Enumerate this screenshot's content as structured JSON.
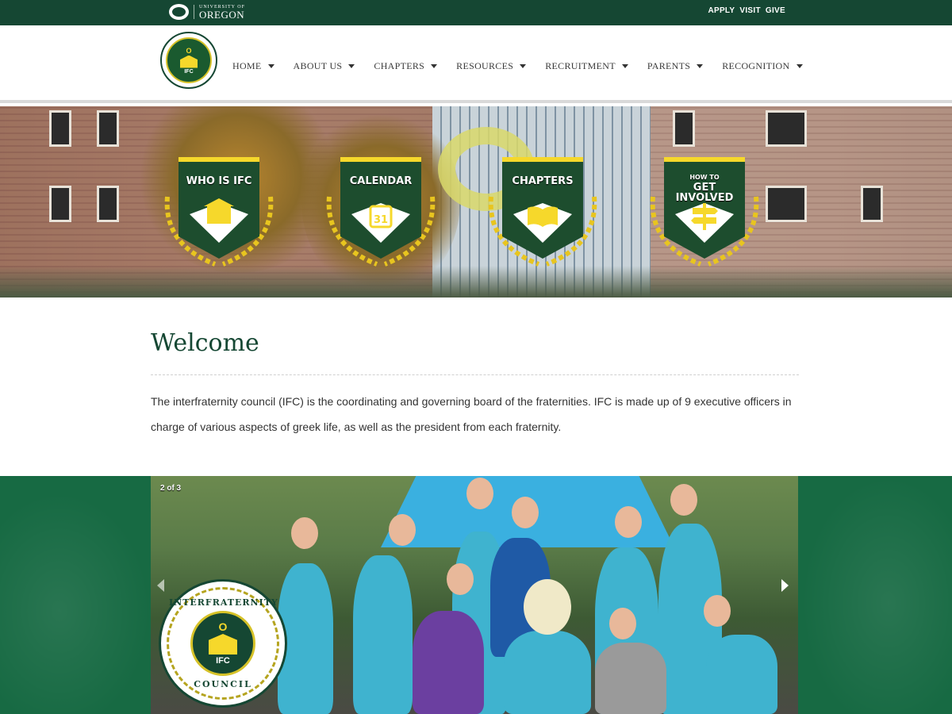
{
  "topbar": {
    "logo_small": "UNIVERSITY OF",
    "logo_big": "OREGON",
    "links": [
      "APPLY",
      "VISIT",
      "GIVE"
    ]
  },
  "header": {
    "seal_ifc": "IFC",
    "nav": [
      "HOME",
      "ABOUT US",
      "CHAPTERS",
      "RESOURCES",
      "RECRUITMENT",
      "PARENTS",
      "RECOGNITION"
    ]
  },
  "hero": {
    "badges": [
      {
        "sub": "",
        "label": "WHO IS IFC",
        "icon": "building-icon"
      },
      {
        "sub": "",
        "label": "CALENDAR",
        "icon": "calendar-icon",
        "icon_text": "31"
      },
      {
        "sub": "",
        "label": "CHAPTERS",
        "icon": "book-icon"
      },
      {
        "sub": "HOW TO",
        "label": "GET INVOLVED",
        "icon": "signpost-icon"
      }
    ]
  },
  "welcome": {
    "title": "Welcome",
    "body": "The interfraternity council (IFC) is the coordinating and governing board of the fraternities. IFC is made up of 9 executive officers in charge of various aspects of greek life, as well as the president from each fraternity."
  },
  "slideshow": {
    "counter": "2 of 3",
    "seal_top": "INTERFRATERNITY",
    "seal_bottom": "COUNCIL",
    "seal_ifc": "IFC",
    "seal_o": "O"
  },
  "colors": {
    "green": "#154733",
    "yellow": "#f6d82b",
    "band": "#176a43"
  }
}
